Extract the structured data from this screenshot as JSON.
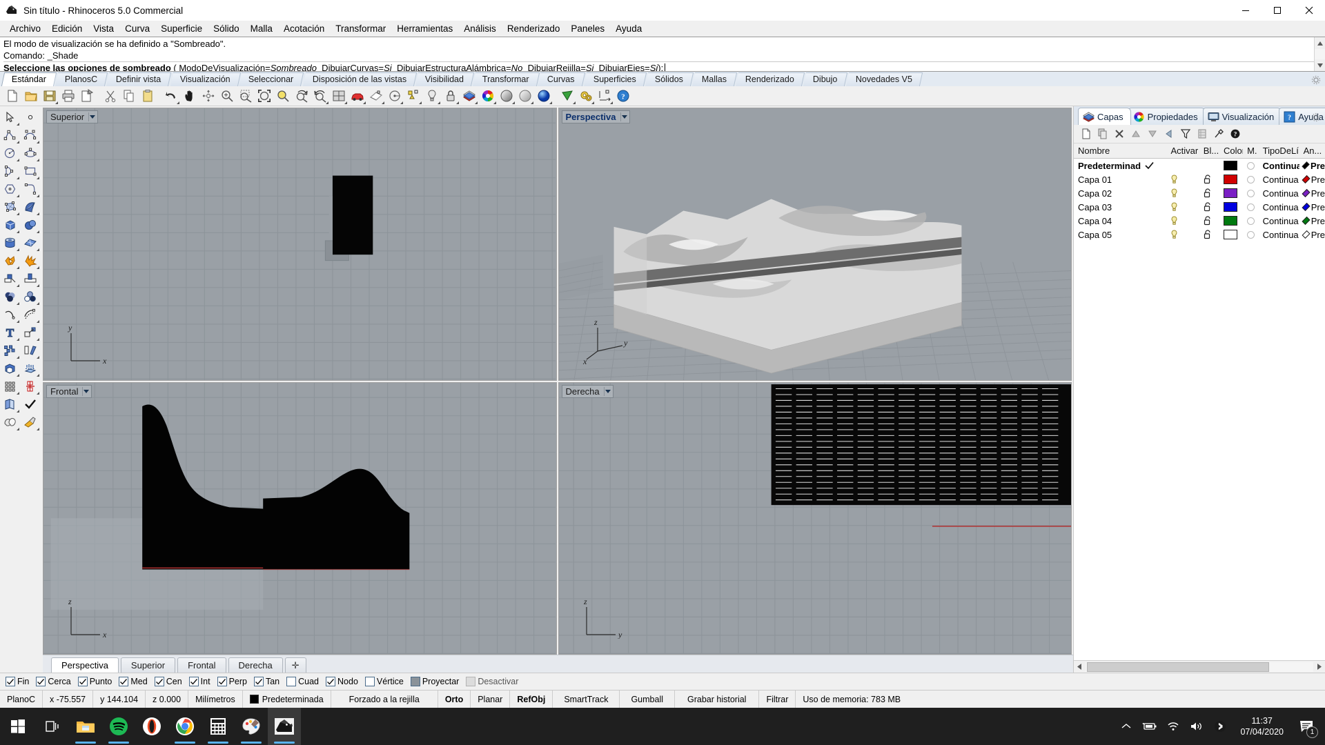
{
  "window": {
    "title": "Sin título - Rhinoceros 5.0 Commercial",
    "app_icon": "rhino-icon",
    "minimize_label": "Minimizar",
    "maximize_label": "Maximizar",
    "close_label": "Cerrar"
  },
  "menubar": {
    "items": [
      {
        "label": "Archivo"
      },
      {
        "label": "Edición"
      },
      {
        "label": "Vista"
      },
      {
        "label": "Curva"
      },
      {
        "label": "Superficie"
      },
      {
        "label": "Sólido"
      },
      {
        "label": "Malla"
      },
      {
        "label": "Acotación"
      },
      {
        "label": "Transformar"
      },
      {
        "label": "Herramientas"
      },
      {
        "label": "Análisis"
      },
      {
        "label": "Renderizado"
      },
      {
        "label": "Paneles"
      },
      {
        "label": "Ayuda"
      }
    ]
  },
  "command_area": {
    "history_line_1": "El modo de visualización se ha definido a \"Sombreado\".",
    "history_line_2": "Comando: _Shade",
    "prompt_bold": "Seleccione las opciones de sombreado",
    "prompt_open_paren": "(",
    "prompt_options": [
      {
        "name": "ModoDeVisualización",
        "mnemonic": "M",
        "rest": "odoDeVisualización",
        "value": "Sombreado"
      },
      {
        "name": "DibujarCurvas",
        "mnemonic": "D",
        "rest": "ibujarCurvas",
        "value": "Si"
      },
      {
        "name": "DibujarEstructuraAlámbrica",
        "mnemonic": "Di",
        "rest": "bujarEstructuraAlámbrica",
        "value": "No"
      },
      {
        "name": "DibujarRejilla",
        "mnemonic": "Dib",
        "rest": "ujarRejilla",
        "value": "Si"
      },
      {
        "name": "DibujarEjes",
        "mnemonic": "Dibu",
        "rest": "jarEjes",
        "value": "Si"
      }
    ],
    "prompt_close": "):"
  },
  "toolbar_tabs": {
    "items": [
      {
        "label": "Estándar",
        "active": true
      },
      {
        "label": "PlanosC",
        "active": false
      },
      {
        "label": "Definir vista",
        "active": false
      },
      {
        "label": "Visualización",
        "active": false
      },
      {
        "label": "Seleccionar",
        "active": false
      },
      {
        "label": "Disposición de las vistas",
        "active": false
      },
      {
        "label": "Visibilidad",
        "active": false
      },
      {
        "label": "Transformar",
        "active": false
      },
      {
        "label": "Curvas",
        "active": false
      },
      {
        "label": "Superficies",
        "active": false
      },
      {
        "label": "Sólidos",
        "active": false
      },
      {
        "label": "Mallas",
        "active": false
      },
      {
        "label": "Renderizado",
        "active": false
      },
      {
        "label": "Dibujo",
        "active": false
      },
      {
        "label": "Novedades V5",
        "active": false
      }
    ],
    "options_icon": "gear-icon"
  },
  "main_toolbar": {
    "icons": [
      "new-file-icon",
      "open-folder-icon",
      "save-icon",
      "print-icon",
      "copy-to-clipboard-icon",
      "cut-icon",
      "copy-icon",
      "paste-icon",
      "undo-icon",
      "pan-icon",
      "rotate-view-icon",
      "zoom-in-icon",
      "zoom-window-icon",
      "zoom-extents-icon",
      "zoom-selected-icon",
      "zoom-dynamic-icon",
      "zoom-previous-icon",
      "viewport-layout-icon",
      "car-icon",
      "plane-icon",
      "named-cplane-icon",
      "object-snap-icon",
      "light-bulb-icon",
      "lock-icon",
      "layers-icon",
      "color-wheel-icon",
      "render-shaded-icon",
      "render-ghosted-icon",
      "render-icon",
      "spotlight-icon",
      "options-gear-icon",
      "dimension-icon",
      "help-icon"
    ]
  },
  "left_toolbar": {
    "icons": [
      "select-arrow-icon",
      "point-icon",
      "polyline-icon",
      "curve-control-points-icon",
      "circle-icon",
      "ellipse-icon",
      "arc-icon",
      "rectangle-icon",
      "polygon-icon",
      "curve-fillet-icon",
      "surface-from-points-icon",
      "surface-loft-icon",
      "box-icon",
      "sphere-icon",
      "cylinder-icon",
      "surface-plane-icon",
      "boolean-union-icon",
      "explode-icon",
      "trim-icon",
      "split-icon",
      "boolean-difference-icon",
      "boolean-intersect-icon",
      "offset-curve-icon",
      "fillet-curve-icon",
      "text-icon",
      "scale-icon",
      "array-icon",
      "mirror-icon",
      "cap-holes-icon",
      "extrude-icon",
      "grid-array-icon",
      "rebuild-icon",
      "unroll-surface-icon",
      "check-object-icon",
      "mesh-from-surface-icon",
      "render-material-icon"
    ]
  },
  "viewports": [
    {
      "name": "top-viewport",
      "label": "Superior",
      "active": false,
      "axes": [
        {
          "label": "y",
          "dir": "up"
        },
        {
          "label": "x",
          "dir": "right"
        }
      ]
    },
    {
      "name": "perspective-viewport",
      "label": "Perspectiva",
      "active": true,
      "axes": [
        {
          "label": "z",
          "dir": "up"
        },
        {
          "label": "y",
          "dir": "right"
        },
        {
          "label": "x",
          "dir": "down-left"
        }
      ]
    },
    {
      "name": "front-viewport",
      "label": "Frontal",
      "active": false,
      "axes": [
        {
          "label": "z",
          "dir": "up"
        },
        {
          "label": "x",
          "dir": "right"
        }
      ]
    },
    {
      "name": "right-viewport",
      "label": "Derecha",
      "active": false,
      "axes": [
        {
          "label": "z",
          "dir": "up"
        },
        {
          "label": "y",
          "dir": "right"
        }
      ]
    }
  ],
  "viewport_tabs": {
    "items": [
      {
        "label": "Perspectiva",
        "active": true
      },
      {
        "label": "Superior",
        "active": false
      },
      {
        "label": "Frontal",
        "active": false
      },
      {
        "label": "Derecha",
        "active": false
      }
    ],
    "add_label": "✛"
  },
  "panel": {
    "tabs": [
      {
        "label": "Capas",
        "icon": "layers-icon",
        "active": true
      },
      {
        "label": "Propiedades",
        "icon": "color-wheel-icon",
        "active": false
      },
      {
        "label": "Visualización",
        "icon": "monitor-icon",
        "active": false
      },
      {
        "label": "Ayuda",
        "icon": "help-icon",
        "active": false
      }
    ],
    "options_icon": "gear-icon",
    "toolbar_icons": [
      "new-layer-icon",
      "copy-layer-icon",
      "delete-layer-icon",
      "move-up-icon",
      "move-down-icon",
      "previous-icon",
      "filter-icon",
      "layer-sheet-icon",
      "layer-tools-icon",
      "help-icon"
    ],
    "columns": [
      {
        "key": "name",
        "label": "Nombre"
      },
      {
        "key": "current",
        "label": ""
      },
      {
        "key": "on",
        "label": "Activar"
      },
      {
        "key": "lock",
        "label": "Bl..."
      },
      {
        "key": "color",
        "label": "Color"
      },
      {
        "key": "material",
        "label": "M."
      },
      {
        "key": "linetype",
        "label": "TipoDeLí..."
      },
      {
        "key": "printwidth",
        "label": "An..."
      }
    ],
    "rows": [
      {
        "name": "Predeterminada",
        "current": true,
        "on": false,
        "lock": false,
        "color": "#000000",
        "linetype": "Continua",
        "printwidth": "Pre",
        "bold": true
      },
      {
        "name": "Capa 01",
        "current": false,
        "on": true,
        "lock": true,
        "color": "#d00000",
        "linetype": "Continua",
        "printwidth": "Pre",
        "bold": false
      },
      {
        "name": "Capa 02",
        "current": false,
        "on": true,
        "lock": true,
        "color": "#7a1fc4",
        "linetype": "Continua",
        "printwidth": "Pre",
        "bold": false
      },
      {
        "name": "Capa 03",
        "current": false,
        "on": true,
        "lock": true,
        "color": "#0000e0",
        "linetype": "Continua",
        "printwidth": "Pre",
        "bold": false
      },
      {
        "name": "Capa 04",
        "current": false,
        "on": true,
        "lock": true,
        "color": "#007a10",
        "linetype": "Continua",
        "printwidth": "Pre",
        "bold": false
      },
      {
        "name": "Capa 05",
        "current": false,
        "on": true,
        "lock": true,
        "color": "#ffffff",
        "linetype": "Continua",
        "printwidth": "Pre",
        "bold": false
      }
    ]
  },
  "osnap": {
    "items": [
      {
        "label": "Fin",
        "state": "checked"
      },
      {
        "label": "Cerca",
        "state": "checked"
      },
      {
        "label": "Punto",
        "state": "checked"
      },
      {
        "label": "Med",
        "state": "checked"
      },
      {
        "label": "Cen",
        "state": "checked"
      },
      {
        "label": "Int",
        "state": "checked"
      },
      {
        "label": "Perp",
        "state": "checked"
      },
      {
        "label": "Tan",
        "state": "checked"
      },
      {
        "label": "Cuad",
        "state": "unchecked"
      },
      {
        "label": "Nodo",
        "state": "checked"
      },
      {
        "label": "Vértice",
        "state": "unchecked"
      },
      {
        "label": "Proyectar",
        "state": "filled"
      },
      {
        "label": "Desactivar",
        "state": "disabled"
      }
    ]
  },
  "statusbar": {
    "cplane": "PlanoC",
    "x": "x -75.557",
    "y": "y 144.104",
    "z": "z 0.000",
    "units": "Milímetros",
    "layer": "Predeterminada",
    "layer_color": "#000000",
    "snap": "Forzado a la rejilla",
    "ortho": "Orto",
    "planar": "Planar",
    "osnap": "RefObj",
    "smarttrack": "SmartTrack",
    "gumball": "Gumball",
    "history": "Grabar historial",
    "filter": "Filtrar",
    "memory": "Uso de memoria: 783 MB"
  },
  "taskbar": {
    "items": [
      {
        "name": "start-button",
        "icon": "windows-logo-icon"
      },
      {
        "name": "task-view-button",
        "icon": "task-view-icon"
      },
      {
        "name": "file-explorer",
        "icon": "folder-icon",
        "running": true
      },
      {
        "name": "spotify",
        "icon": "spotify-icon",
        "running": true
      },
      {
        "name": "opera",
        "icon": "opera-icon",
        "running": false
      },
      {
        "name": "chrome",
        "icon": "chrome-icon",
        "running": true
      },
      {
        "name": "calculator",
        "icon": "calculator-icon",
        "running": true
      },
      {
        "name": "paint",
        "icon": "paint-icon",
        "running": true
      },
      {
        "name": "rhinoceros",
        "icon": "rhino-icon",
        "running": true,
        "focused": true
      }
    ],
    "tray": [
      {
        "name": "show-hidden-icons",
        "icon": "chevron-up-icon"
      },
      {
        "name": "battery",
        "icon": "battery-charging-icon"
      },
      {
        "name": "network",
        "icon": "wifi-icon"
      },
      {
        "name": "volume",
        "icon": "speaker-icon"
      },
      {
        "name": "bluetooth",
        "icon": "bluetooth-icon"
      }
    ],
    "clock_time": "11:37",
    "clock_date": "07/04/2020",
    "notification_count": "1"
  }
}
